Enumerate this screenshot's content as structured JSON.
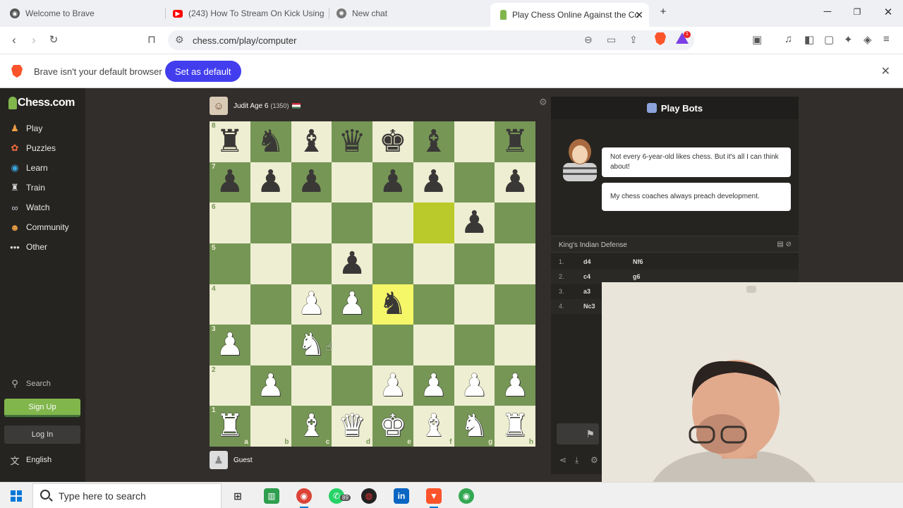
{
  "browser": {
    "tabs": [
      {
        "title": "Welcome to Brave",
        "icon": "brave-globe-icon"
      },
      {
        "title": "(243) How To Stream On Kick Using O",
        "icon": "youtube-icon"
      },
      {
        "title": "New chat",
        "icon": "chat-icon"
      },
      {
        "title": "Play Chess Online Against the Co",
        "icon": "chess-pawn-icon",
        "active": true
      }
    ],
    "url": "chess.com/play/computer",
    "shield_count": "1",
    "infobar": {
      "text": "Brave isn't your default browser",
      "button": "Set as default"
    }
  },
  "sidebar": {
    "logo": "Chess.com",
    "nav": [
      {
        "label": "Play",
        "icon": "play-pawn-icon",
        "color": "#f0a046"
      },
      {
        "label": "Puzzles",
        "icon": "puzzle-icon",
        "color": "#f06d3c"
      },
      {
        "label": "Learn",
        "icon": "learn-icon",
        "color": "#3ba6e0"
      },
      {
        "label": "Train",
        "icon": "train-icon",
        "color": "#d9d9d9"
      },
      {
        "label": "Watch",
        "icon": "binoculars-icon",
        "color": "#c7d0da"
      },
      {
        "label": "Community",
        "icon": "community-icon",
        "color": "#f0a046"
      },
      {
        "label": "Other",
        "icon": "ellipsis-icon",
        "color": "#d9d9d9"
      }
    ],
    "search": "Search",
    "signup": "Sign Up",
    "login": "Log In",
    "language": "English"
  },
  "game": {
    "opponent": {
      "name": "Judit Age 6",
      "rating": "(1350)"
    },
    "player": {
      "name": "Guest"
    },
    "files": [
      "a",
      "b",
      "c",
      "d",
      "e",
      "f",
      "g",
      "h"
    ],
    "ranks": [
      "8",
      "7",
      "6",
      "5",
      "4",
      "3",
      "2",
      "1"
    ],
    "board": [
      [
        "br",
        "bn",
        "bb",
        "bq",
        "bk",
        "bb",
        "",
        "br"
      ],
      [
        "bp",
        "bp",
        "bp",
        "",
        "bp",
        "bp",
        "",
        "bp"
      ],
      [
        "",
        "",
        "",
        "",
        "",
        "",
        "bp",
        ""
      ],
      [
        "",
        "",
        "",
        "bp",
        "",
        "",
        "",
        ""
      ],
      [
        "",
        "",
        "wp",
        "wp",
        "bn",
        "",
        "",
        ""
      ],
      [
        "wp",
        "",
        "wn",
        "",
        "",
        "",
        "",
        ""
      ],
      [
        "",
        "wp",
        "",
        "",
        "wp",
        "wp",
        "wp",
        "wp"
      ],
      [
        "wr",
        "",
        "wb",
        "wq",
        "wk",
        "wb",
        "wn",
        "wr"
      ]
    ],
    "highlight": [
      [
        2,
        5
      ],
      [
        4,
        4
      ]
    ]
  },
  "panel": {
    "title": "Play Bots",
    "messages": [
      "Not every 6-year-old likes chess. But it's all I can think about!",
      "My chess coaches always preach development."
    ],
    "opening": "King's Indian Defense",
    "moves": [
      {
        "n": "1.",
        "w": "d4",
        "b": "Nf6"
      },
      {
        "n": "2.",
        "w": "c4",
        "b": "g6"
      },
      {
        "n": "3.",
        "w": "a3",
        "b": ""
      },
      {
        "n": "4.",
        "w": "Nc3",
        "b": ""
      }
    ]
  },
  "taskbar": {
    "search_placeholder": "Type here to search",
    "whatsapp_badge": "89"
  }
}
